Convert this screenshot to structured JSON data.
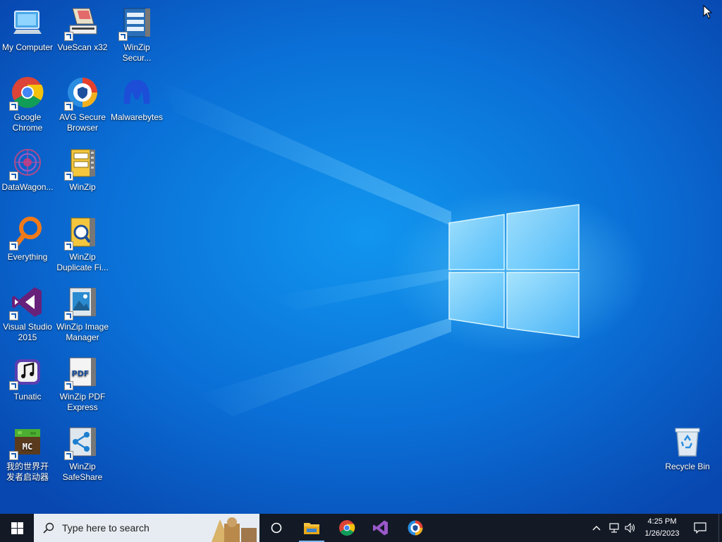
{
  "desktop": {
    "icons": [
      {
        "label": "My Computer",
        "icon": "computer-icon"
      },
      {
        "label": "VueScan x32",
        "icon": "scanner-icon"
      },
      {
        "label": "WinZip Secur...",
        "icon": "winzip-secure-icon"
      },
      {
        "label": "Google Chrome",
        "icon": "chrome-icon"
      },
      {
        "label": "AVG Secure Browser",
        "icon": "avg-browser-icon"
      },
      {
        "label": "Malwarebytes",
        "icon": "malwarebytes-icon"
      },
      {
        "label": "DataWagon...",
        "icon": "datawagon-icon"
      },
      {
        "label": "WinZip",
        "icon": "winzip-icon"
      },
      {
        "label": "Everything",
        "icon": "everything-search-icon"
      },
      {
        "label": "WinZip Duplicate Fi...",
        "icon": "winzip-duplicate-icon"
      },
      {
        "label": "Visual Studio 2015",
        "icon": "visual-studio-icon"
      },
      {
        "label": "WinZip Image Manager",
        "icon": "winzip-image-icon"
      },
      {
        "label": "Tunatic",
        "icon": "tunatic-icon"
      },
      {
        "label": "WinZip PDF Express",
        "icon": "winzip-pdf-icon"
      },
      {
        "label": "我的世界开发者启动器",
        "icon": "minecraft-icon"
      },
      {
        "label": "WinZip SafeShare",
        "icon": "winzip-safeshare-icon"
      },
      {
        "label": "Recycle Bin",
        "icon": "recycle-bin-icon"
      }
    ]
  },
  "taskbar": {
    "search_placeholder": "Type here to search",
    "pinned": [
      "file-explorer-icon",
      "chrome-icon",
      "visual-studio-icon",
      "avg-browser-icon"
    ],
    "clock": {
      "time": "4:25 PM",
      "date": "1/26/2023"
    }
  },
  "colors": {
    "taskbar": "#131a26",
    "desktop_accent": "#0a6fd6"
  }
}
